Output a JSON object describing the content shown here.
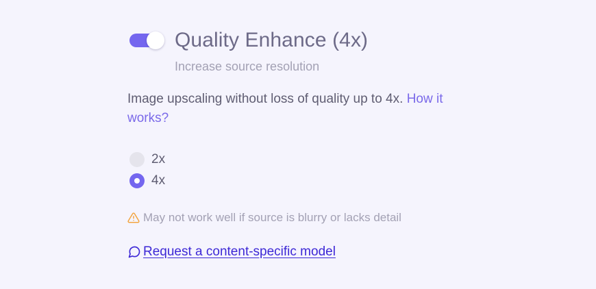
{
  "feature": {
    "title": "Quality Enhance (4x)",
    "subtitle": "Increase source resolution",
    "toggle_on": true
  },
  "description": {
    "text": "Image upscaling without loss of quality up to 4x. ",
    "link_label": "How it works?"
  },
  "scale_options": [
    {
      "label": "2x",
      "selected": false
    },
    {
      "label": "4x",
      "selected": true
    }
  ],
  "warning": {
    "icon": "warning-triangle-icon",
    "text": "May not work well if source is blurry or lacks detail"
  },
  "request_link": {
    "icon": "chat-bubble-icon",
    "label": "Request a content-specific model"
  },
  "colors": {
    "accent": "#7466ef",
    "link": "#3d28d6",
    "warning": "#f3a540",
    "background": "#f5f4fd"
  }
}
